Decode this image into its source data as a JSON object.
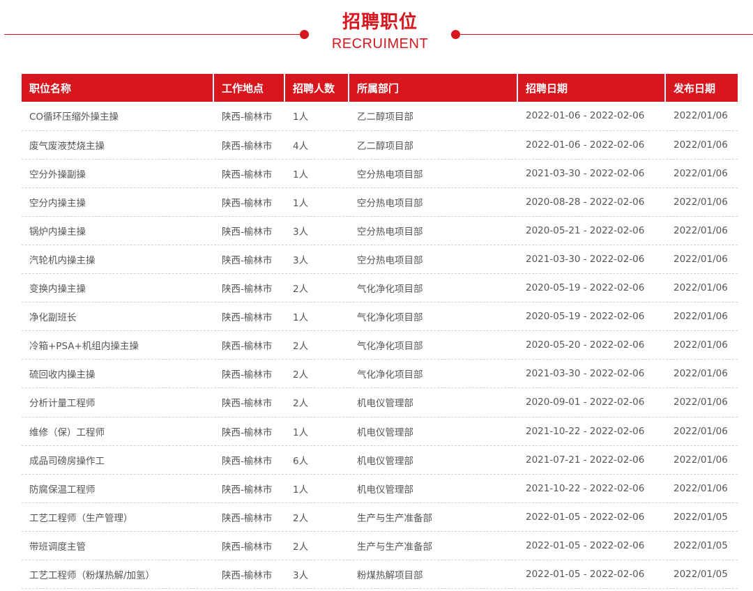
{
  "header": {
    "title": "招聘职位",
    "subtitle": "RECRUIMENT",
    "accent_color": "#d7161e"
  },
  "table": {
    "columns": [
      "职位名称",
      "工作地点",
      "招聘人数",
      "所属部门",
      "招聘日期",
      "发布日期"
    ],
    "rows": [
      [
        "CO循环压缩外操主操",
        "陕西-榆林市",
        "1人",
        "乙二醇项目部",
        "2022-01-06 - 2022-02-06",
        "2022/01/06"
      ],
      [
        "废气废液焚烧主操",
        "陕西-榆林市",
        "4人",
        "乙二醇项目部",
        "2022-01-06 - 2022-02-06",
        "2022/01/06"
      ],
      [
        "空分外操副操",
        "陕西-榆林市",
        "1人",
        "空分热电项目部",
        "2021-03-30 - 2022-02-06",
        "2022/01/06"
      ],
      [
        "空分内操主操",
        "陕西-榆林市",
        "1人",
        "空分热电项目部",
        "2020-08-28 - 2022-02-06",
        "2022/01/06"
      ],
      [
        "锅炉内操主操",
        "陕西-榆林市",
        "3人",
        "空分热电项目部",
        "2020-05-21 - 2022-02-06",
        "2022/01/06"
      ],
      [
        "汽轮机内操主操",
        "陕西-榆林市",
        "3人",
        "空分热电项目部",
        "2021-03-30 - 2022-02-06",
        "2022/01/06"
      ],
      [
        "变换内操主操",
        "陕西-榆林市",
        "2人",
        "气化净化项目部",
        "2020-05-19 - 2022-02-06",
        "2022/01/06"
      ],
      [
        "净化副班长",
        "陕西-榆林市",
        "1人",
        "气化净化项目部",
        "2020-05-19 - 2022-02-06",
        "2022/01/06"
      ],
      [
        "冷箱+PSA+机组内操主操",
        "陕西-榆林市",
        "2人",
        "气化净化项目部",
        "2020-05-20 - 2022-02-06",
        "2022/01/06"
      ],
      [
        "硫回收内操主操",
        "陕西-榆林市",
        "2人",
        "气化净化项目部",
        "2021-03-30 - 2022-02-06",
        "2022/01/06"
      ],
      [
        "分析计量工程师",
        "陕西-榆林市",
        "2人",
        "机电仪管理部",
        "2020-09-01 - 2022-02-06",
        "2022/01/06"
      ],
      [
        "维修（保）工程师",
        "陕西-榆林市",
        "1人",
        "机电仪管理部",
        "2021-10-22 - 2022-02-06",
        "2022/01/06"
      ],
      [
        "成品司磅房操作工",
        "陕西-榆林市",
        "6人",
        "机电仪管理部",
        "2021-07-21 - 2022-02-06",
        "2022/01/06"
      ],
      [
        "防腐保温工程师",
        "陕西-榆林市",
        "1人",
        "机电仪管理部",
        "2021-10-22 - 2022-02-06",
        "2022/01/06"
      ],
      [
        "工艺工程师（生产管理）",
        "陕西-榆林市",
        "2人",
        "生产与生产准备部",
        "2022-01-05 - 2022-02-06",
        "2022/01/05"
      ],
      [
        "带班调度主管",
        "陕西-榆林市",
        "2人",
        "生产与生产准备部",
        "2022-01-05 - 2022-02-06",
        "2022/01/05"
      ],
      [
        "工艺工程师（粉煤热解/加氢）",
        "陕西-榆林市",
        "3人",
        "粉煤热解项目部",
        "2022-01-05 - 2022-02-06",
        "2022/01/05"
      ]
    ]
  }
}
